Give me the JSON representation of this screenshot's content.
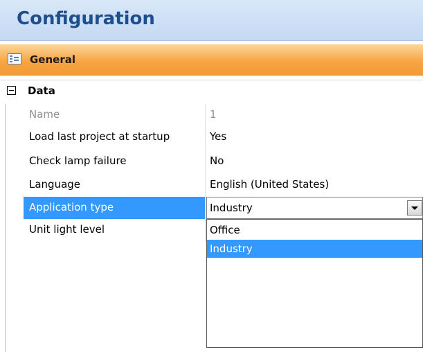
{
  "header": {
    "title": "Configuration"
  },
  "category": {
    "icon": "property-pages-icon",
    "label": "General"
  },
  "group": {
    "expander_icon": "collapse-minus-icon",
    "label": "Data"
  },
  "properties": [
    {
      "name": "Name",
      "value": "1",
      "enabled": false
    },
    {
      "name": "Load last project at startup",
      "value": "Yes",
      "enabled": true
    },
    {
      "name": "Check lamp failure",
      "value": "No",
      "enabled": true
    },
    {
      "name": "Language",
      "value": "English (United States)",
      "enabled": true
    },
    {
      "name": "Application type",
      "value": "Industry",
      "enabled": true,
      "selected": true
    },
    {
      "name": "Unit light level",
      "value": "",
      "enabled": true
    }
  ],
  "dropdown": {
    "icon": "chevron-down-icon",
    "options": [
      "Office",
      "Industry"
    ],
    "selected": "Industry"
  },
  "colors": {
    "selection": "#3399ff",
    "category_bar": "#f7a545",
    "header": "#c4d9f3"
  }
}
